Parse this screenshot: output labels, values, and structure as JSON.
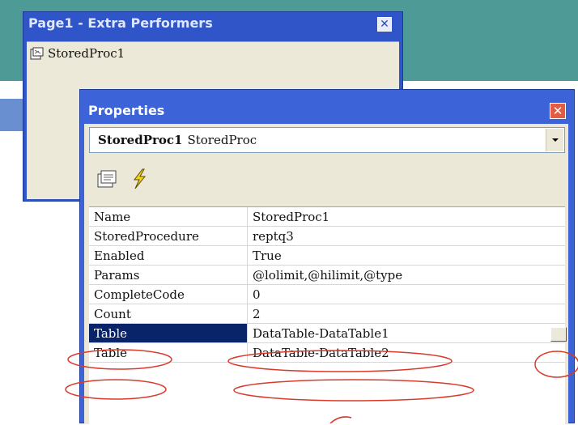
{
  "colors": {
    "title_bar": "#3c63d8",
    "selection": "#0a246a",
    "annotation": "#d93a2b",
    "panel": "#ebe8d7"
  },
  "back_window": {
    "title": "Page1 - Extra Performers",
    "close_icon": "close-icon",
    "items": [
      {
        "label": "StoredProc1",
        "icon": "stored-proc-icon"
      }
    ]
  },
  "properties_window": {
    "title": "Properties",
    "close_icon": "close-icon",
    "object_selector": {
      "name": "StoredProc1",
      "type": "StoredProc",
      "dropdown_icon": "chevron-down-icon"
    },
    "toolbar": [
      {
        "name": "properties-icon"
      },
      {
        "name": "events-lightning-icon"
      }
    ],
    "grid_rows": [
      {
        "key": "Name",
        "value": "StoredProc1"
      },
      {
        "key": "StoredProcedure",
        "value": "reptq3"
      },
      {
        "key": "Enabled",
        "value": "True"
      },
      {
        "key": "Params",
        "value": "@lolimit,@hilimit,@type"
      },
      {
        "key": "CompleteCode",
        "value": "0"
      },
      {
        "key": "Count",
        "value": "2"
      },
      {
        "key": "Table",
        "value": "DataTable-DataTable1",
        "selected": true
      },
      {
        "key": "Table",
        "value": "DataTable-DataTable2"
      }
    ]
  }
}
